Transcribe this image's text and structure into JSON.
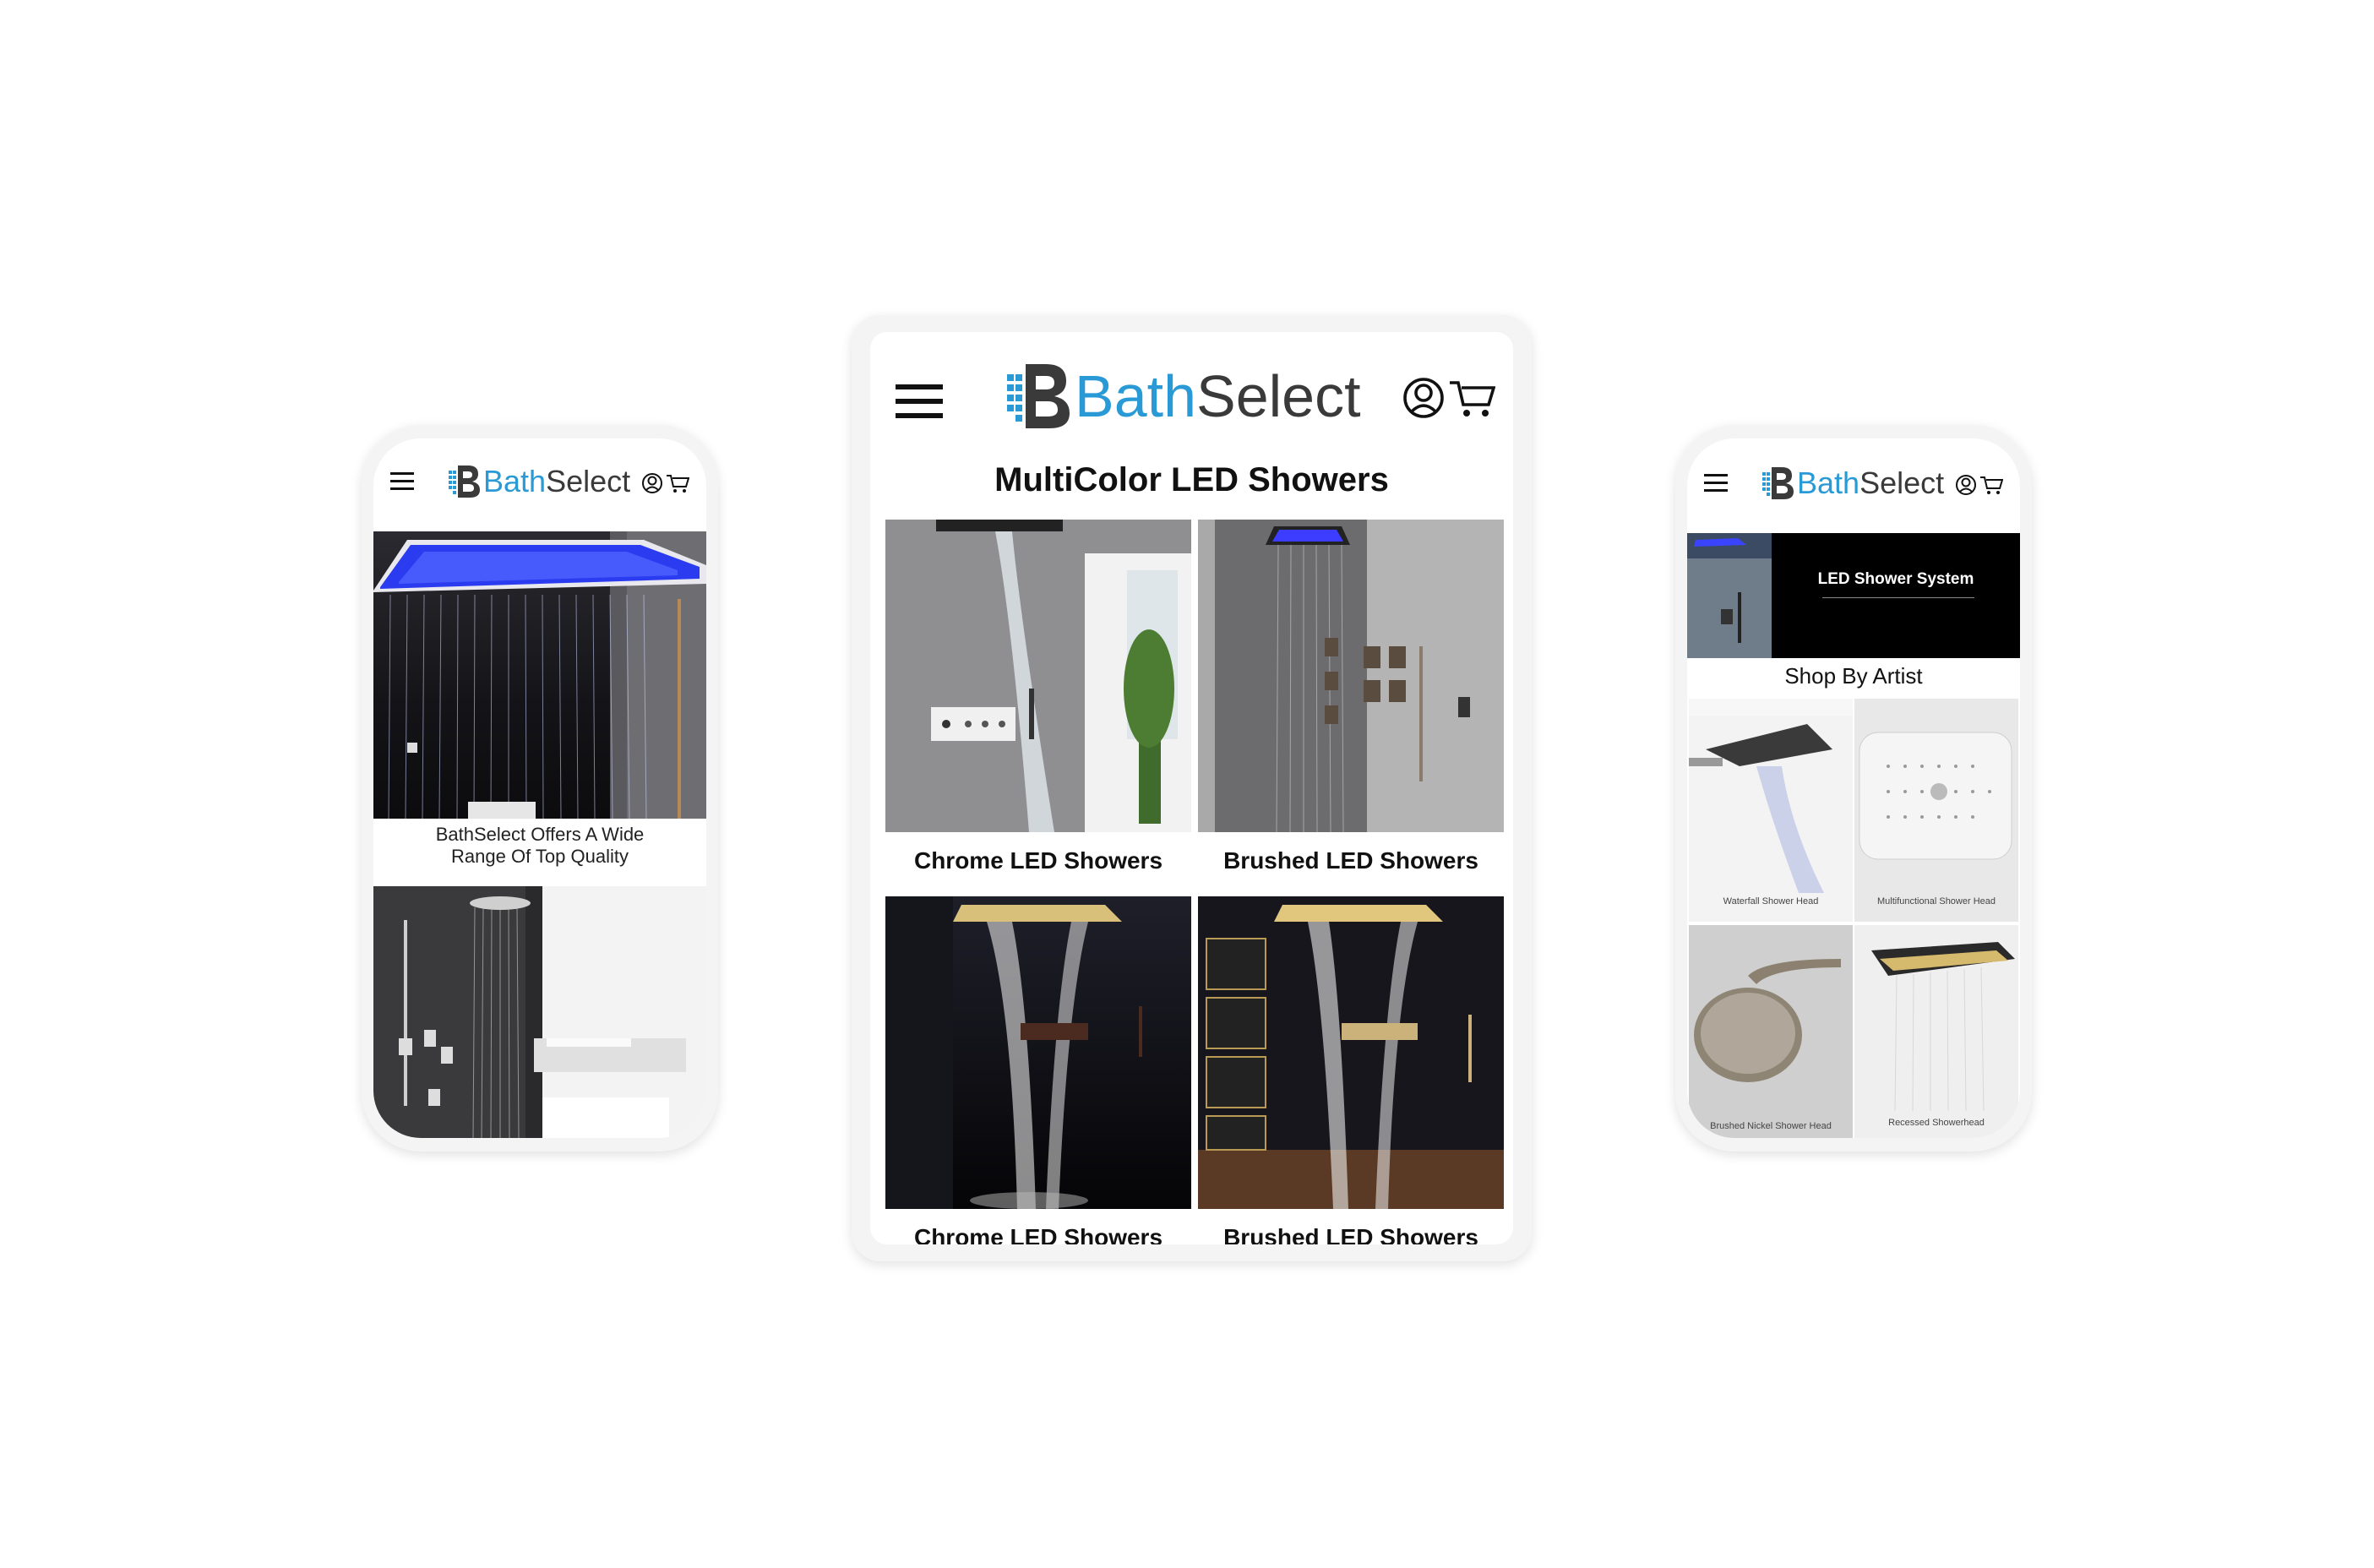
{
  "brand": {
    "part1": "Bath",
    "part2": "Select"
  },
  "colors": {
    "brand_blue": "#2a9ad6",
    "brand_dark": "#3a3a3a",
    "device_frame": "#f4f4f4"
  },
  "icons": {
    "menu": "hamburger-menu-icon",
    "account": "user-icon",
    "cart": "cart-icon",
    "logo": "bathselect-logo-icon"
  },
  "left_phone": {
    "caption_line1": "BathSelect Offers A Wide",
    "caption_line2": "Range Of Top Quality"
  },
  "tablet": {
    "title": "MultiColor LED Showers",
    "tiles": [
      {
        "label": "Chrome LED Showers"
      },
      {
        "label": "Brushed LED Showers"
      },
      {
        "label": "Chrome LED Showers"
      },
      {
        "label": "Brushed LED Showers"
      }
    ]
  },
  "right_phone": {
    "banner_title": "LED Shower System",
    "section_title": "Shop By Artist",
    "tiles": [
      {
        "label": "Waterfall Shower Head"
      },
      {
        "label": "Multifunctional Shower Head"
      },
      {
        "label": "Brushed Nickel Shower Head"
      },
      {
        "label": "Recessed Showerhead"
      }
    ]
  }
}
